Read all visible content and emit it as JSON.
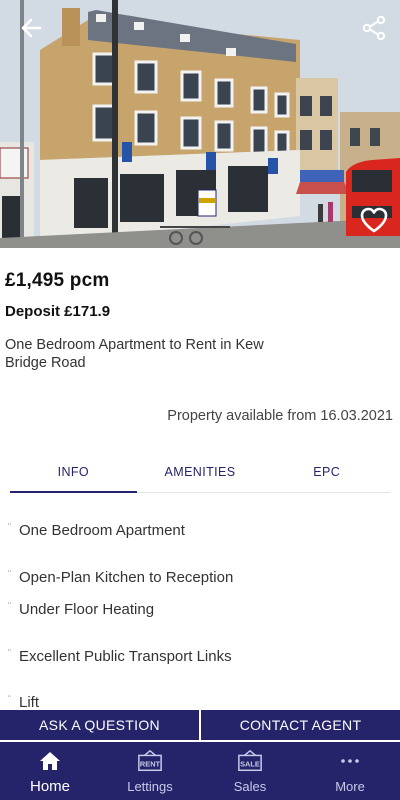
{
  "listing": {
    "price": "£1,495 pcm",
    "deposit": "Deposit £171.9",
    "description": "One Bedroom Apartment to Rent in Kew Bridge Road",
    "available": "Property available from 16.03.2021"
  },
  "photo": {
    "alt": "Street view of the brick apartment building on Kew Bridge Road"
  },
  "tabs": [
    {
      "label": "INFO",
      "active": true
    },
    {
      "label": "AMENITIES",
      "active": false
    },
    {
      "label": "EPC",
      "active": false
    }
  ],
  "features": [
    "One Bedroom Apartment",
    "Open-Plan Kitchen to Reception",
    "Under Floor Heating",
    "Excellent Public Transport Links",
    "Lift"
  ],
  "bullet_glyph": "¨",
  "actions": {
    "ask_question": "ASK A QUESTION",
    "contact_agent": "CONTACT AGENT"
  },
  "nav": {
    "home": "Home",
    "lettings": "Lettings",
    "sales": "Sales",
    "more": "More",
    "rent_sign": "RENT",
    "sale_sign": "SALE"
  },
  "colors": {
    "brand_navy": "#25246b",
    "heart_outline": "#ffffff"
  },
  "icons": {
    "back": "back-arrow-icon",
    "share": "share-icon",
    "favourite": "heart-outline-icon",
    "home": "home-icon",
    "lettings": "rent-sign-icon",
    "sales": "sale-sign-icon",
    "more": "more-dots-icon"
  }
}
